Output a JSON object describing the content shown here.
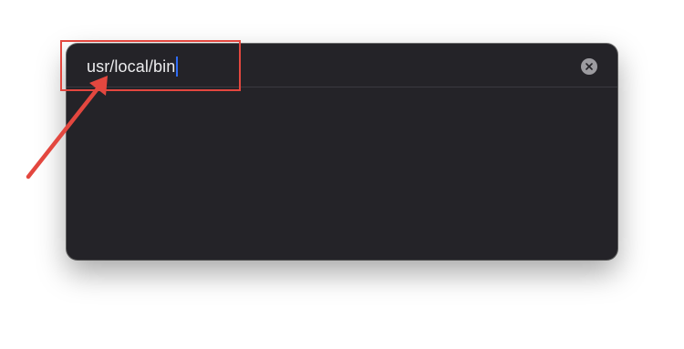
{
  "path_field": {
    "value": "usr/local/bin"
  },
  "icons": {
    "clear": "clear-circle-icon"
  },
  "colors": {
    "dialog_background": "#242328",
    "caret": "#2f6cf5",
    "annotation": "#e3473f"
  }
}
